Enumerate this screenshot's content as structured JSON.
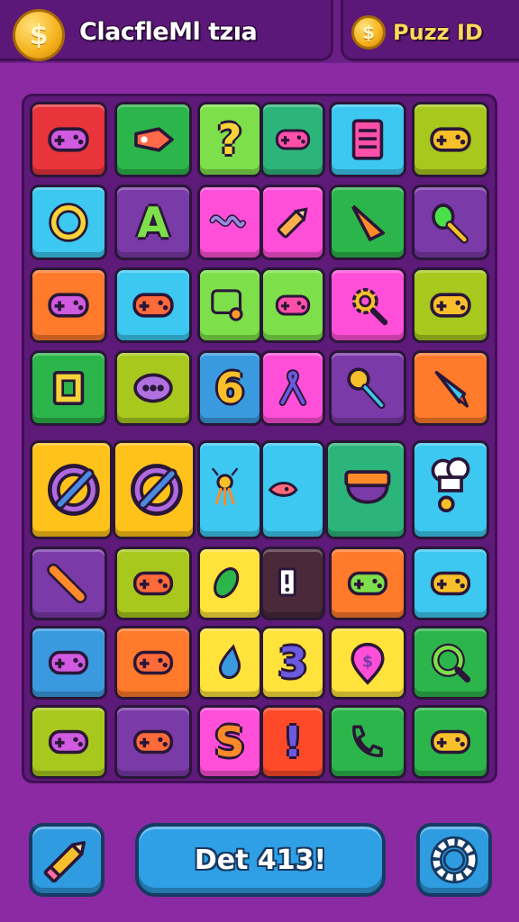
{
  "header": {
    "title": "ClacfleMl tzıa",
    "coin_symbol": "$",
    "score_label": "Puzz ID",
    "score_coin_symbol": "$"
  },
  "footer": {
    "main_button_label": "Det 413!",
    "hint_icon": "pencil-icon",
    "settings_icon": "gear-icon"
  },
  "colors": {
    "background": "#8c2aa3",
    "board": "#5e1a78",
    "button_blue": "#2fa0e6",
    "coin_gold": "#f5b21c"
  },
  "board": {
    "tiles": [
      {
        "bg": "#e8343a",
        "icon": "gamepad-icon"
      },
      {
        "bg": "#2cb54a",
        "icon": "tag-icon"
      },
      {
        "bg": "#7de04a",
        "icon": "question-mark-icon",
        "text": "?"
      },
      {
        "bg": "#2cb57a",
        "icon": "gamepad-icon"
      },
      {
        "bg": "#3cc8f0",
        "icon": "clipboard-icon"
      },
      {
        "bg": "#a8c81e",
        "icon": "gamepad-icon"
      },
      {
        "bg": "#3cc8f0",
        "icon": "ring-icon"
      },
      {
        "bg": "#7a3aa8",
        "icon": "letter-a-icon",
        "text": "A"
      },
      {
        "bg": "#ff4fd8",
        "icon": "wave-icon"
      },
      {
        "bg": "#ff4fd8",
        "icon": "pencil-icon"
      },
      {
        "bg": "#2cb54a",
        "icon": "carrot-icon"
      },
      {
        "bg": "#7a3aa8",
        "icon": "brush-icon"
      },
      {
        "bg": "#ff7a2a",
        "icon": "gamepad-icon"
      },
      {
        "bg": "#3cc8f0",
        "icon": "gamepad-icon"
      },
      {
        "bg": "#7de04a",
        "icon": "chat-icon"
      },
      {
        "bg": "#7de04a",
        "icon": "gamepad-icon"
      },
      {
        "bg": "#ff4fd8",
        "icon": "gear-search-icon"
      },
      {
        "bg": "#a8c81e",
        "icon": "gamepad-icon"
      },
      {
        "bg": "#2cb54a",
        "icon": "square-icon"
      },
      {
        "bg": "#a8c81e",
        "icon": "bug-icon"
      },
      {
        "bg": "#3a9ae0",
        "icon": "number-6-icon",
        "text": "6"
      },
      {
        "bg": "#ff4fd8",
        "icon": "ribbon-icon"
      },
      {
        "bg": "#7a3aa8",
        "icon": "spoon-icon"
      },
      {
        "bg": "#ff7a2a",
        "icon": "rocket-icon"
      },
      {
        "bg": "#ffc21a",
        "icon": "no-sign-icon"
      },
      {
        "bg": "#ffc21a",
        "icon": "no-sign-icon"
      },
      {
        "bg": "#3cc8f0",
        "icon": "squid-icon"
      },
      {
        "bg": "#3cc8f0",
        "icon": "fish-icon"
      },
      {
        "bg": "#2cb57a",
        "icon": "pot-icon"
      },
      {
        "bg": "#3cc8f0",
        "icon": "chef-hat-icon"
      },
      {
        "bg": "#7a3aa8",
        "icon": "bat-icon"
      },
      {
        "bg": "#a8c81e",
        "icon": "gamepad-icon"
      },
      {
        "bg": "#ffe23a",
        "icon": "leaf-icon"
      },
      {
        "bg": "#4a2a3a",
        "icon": "phone-icon"
      },
      {
        "bg": "#ff7a2a",
        "icon": "gamepad-icon"
      },
      {
        "bg": "#3cc8f0",
        "icon": "gamepad-icon"
      },
      {
        "bg": "#3a9ae0",
        "icon": "gamepad-icon"
      },
      {
        "bg": "#ff7a2a",
        "icon": "gamepad-icon"
      },
      {
        "bg": "#ffe23a",
        "icon": "drop-icon"
      },
      {
        "bg": "#ffe23a",
        "icon": "number-3-icon",
        "text": "3"
      },
      {
        "bg": "#ffe23a",
        "icon": "map-pin-icon"
      },
      {
        "bg": "#2cb54a",
        "icon": "search-icon"
      },
      {
        "bg": "#a8c81e",
        "icon": "gamepad-icon"
      },
      {
        "bg": "#7a3aa8",
        "icon": "gamepad-icon"
      },
      {
        "bg": "#ff4fd8",
        "icon": "letter-s-icon",
        "text": "S"
      },
      {
        "bg": "#ff4a2a",
        "icon": "exclamation-icon",
        "text": "!"
      },
      {
        "bg": "#2cb54a",
        "icon": "phone-call-icon"
      },
      {
        "bg": "#2cb54a",
        "icon": "gamepad-icon"
      }
    ]
  }
}
